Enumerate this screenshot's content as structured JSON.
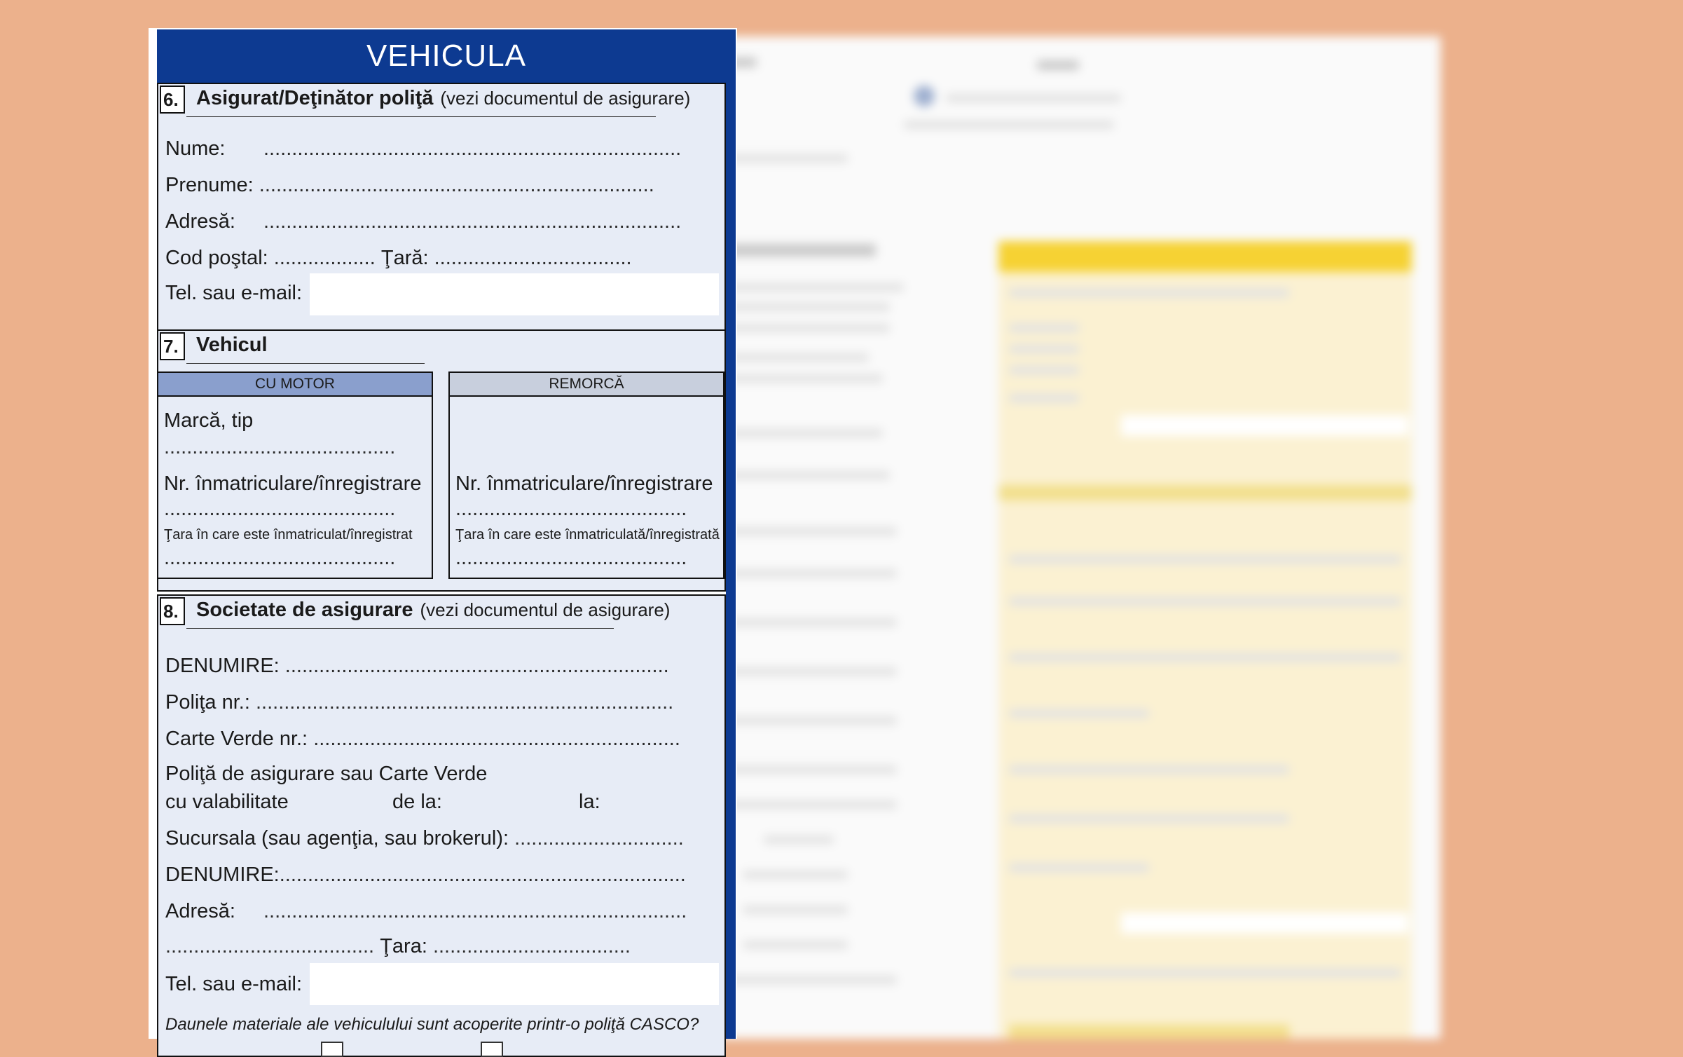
{
  "form": {
    "title": "VEHICULA",
    "section6": {
      "number": "6.",
      "title": "Asigurat/Deţinător poliţă",
      "note": "(vezi documentul de asigurare)",
      "nume_label": "Nume:",
      "nume_dots": "..........................................................................",
      "prenume_label": "Prenume:",
      "prenume_dots": "......................................................................",
      "adresa_label": "Adresă:",
      "adresa_dots": "..........................................................................",
      "cod_postal_label": "Cod poştal:",
      "cod_postal_dots": "..................",
      "tara_label": "Ţară:",
      "tara_dots": "...................................",
      "tel_label": "Tel. sau e-mail:"
    },
    "section7": {
      "number": "7.",
      "title": "Vehicul",
      "motor_head": "CU MOTOR",
      "remorca_head": "REMORCĂ",
      "marca_label": "Marcă, tip",
      "dots_a": ".........................................",
      "nr_label": "Nr. înmatriculare/înregistrare",
      "dots_b": ".........................................",
      "tara_motor_label": "Ţara în care este înmatriculat/înregistrat",
      "dots_c": ".........................................",
      "nr_label_remorca": "Nr. înmatriculare/înregistrare",
      "dots_d": ".........................................",
      "tara_remorca_label": "Ţara în care este înmatriculată/înregistrată",
      "dots_e": "........................................."
    },
    "section8": {
      "number": "8.",
      "title": "Societate de asigurare",
      "note": "(vezi documentul de asigurare)",
      "denumire_label": "DENUMIRE:",
      "denumire_dots": "....................................................................",
      "polita_label": "Poliţa nr.:",
      "polita_dots": "..........................................................................",
      "carte_verde_label": "Carte Verde nr.:",
      "carte_verde_dots": ".................................................................",
      "valabilitate_line1": "Poliţă de asigurare sau Carte Verde",
      "valabilitate_line2": "cu valabilitate",
      "de_la": "de la:",
      "la": "la:",
      "sucursala_label": "Sucursala (sau agenţia, sau brokerul):",
      "sucursala_dots": "..............................",
      "denumire2_label": "DENUMIRE:",
      "denumire2_dots": "........................................................................",
      "adresa_label": "Adresă:",
      "adresa_dots": "...........................................................................",
      "adresa2_dots": ".....................................",
      "tara_label": "Ţara:",
      "tara_dots": "...................................",
      "tel_label": "Tel. sau e-mail:",
      "casco_question": "Daunele materiale ale vehiculului sunt acoperite printr-o poliţă CASCO?"
    }
  },
  "colors": {
    "background": "#ecb18c",
    "header_blue": "#0d3a91",
    "section_bg": "#e7ecf6",
    "motor_head": "#8a9fcd",
    "remorca_head": "#c8cfdd"
  }
}
